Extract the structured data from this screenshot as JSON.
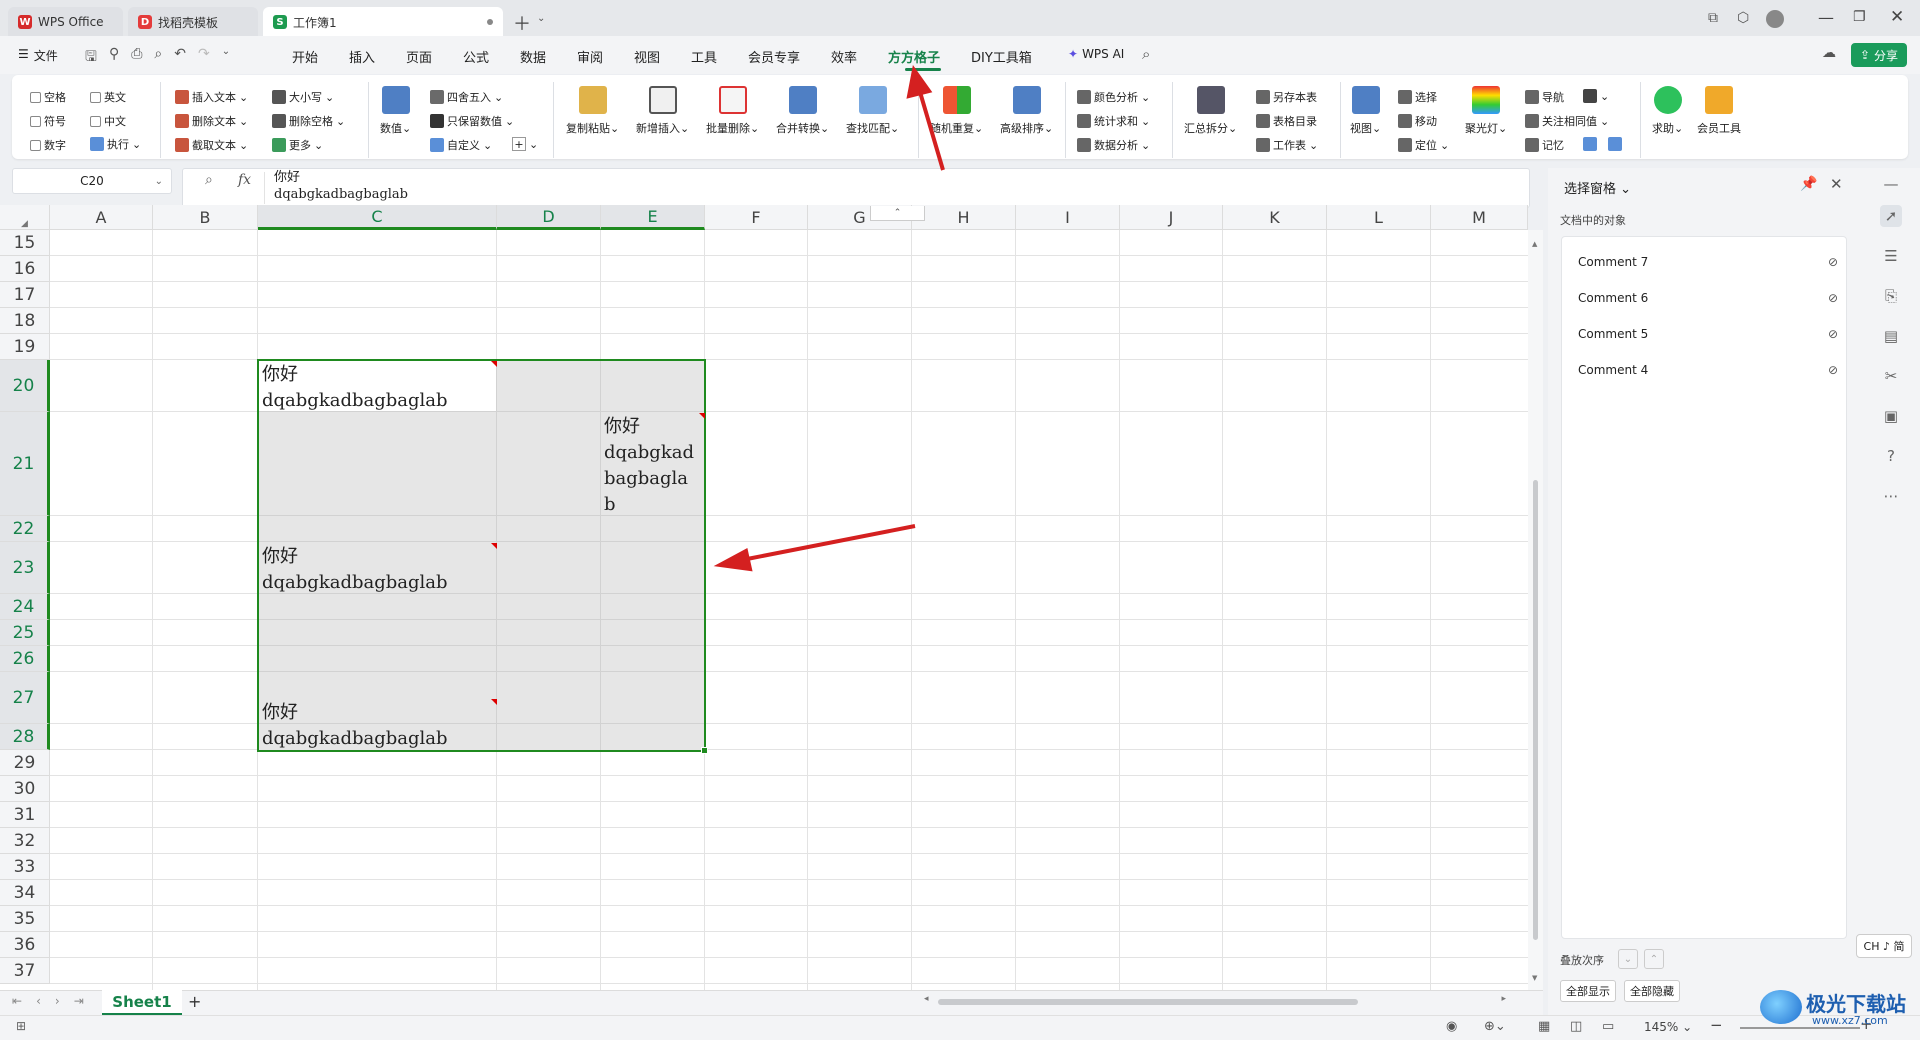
{
  "tabs": [
    {
      "label": "WPS Office",
      "icon": "wps-logo"
    },
    {
      "label": "找稻壳模板",
      "icon": "docer-logo"
    },
    {
      "label": "工作簿1",
      "icon": "sheet-logo"
    }
  ],
  "menu": {
    "file": "文件",
    "items": [
      "开始",
      "插入",
      "页面",
      "公式",
      "数据",
      "审阅",
      "视图",
      "工具",
      "会员专享",
      "效率",
      "方方格子",
      "DIY工具箱"
    ],
    "active": "方方格子",
    "wps_ai": "WPS AI",
    "share": "分享"
  },
  "ribbon": {
    "checks": [
      "空格",
      "英文",
      "符号",
      "中文",
      "数字"
    ],
    "exec": "执行",
    "g2": [
      "插入文本",
      "删除文本",
      "截取文本"
    ],
    "g3": [
      "大小写",
      "删除空格",
      "更多"
    ],
    "numeric": "数值",
    "g4": [
      "四舍五入",
      "只保留数值",
      "自定义"
    ],
    "big1": [
      "复制粘贴",
      "新增插入",
      "批量删除",
      "合并转换",
      "查找匹配",
      "随机重复",
      "高级排序"
    ],
    "g5": [
      "颜色分析",
      "统计求和",
      "数据分析"
    ],
    "summary": "汇总拆分",
    "g6": [
      "另存本表",
      "表格目录",
      "工作表"
    ],
    "view": "视图",
    "g7": [
      "选择",
      "移动",
      "定位"
    ],
    "spotlight": "聚光灯",
    "g8": [
      "导航",
      "关注相同值",
      "记忆"
    ],
    "help": "求助",
    "member_tools": "会员工具"
  },
  "formula": {
    "name_box": "C20",
    "fx": "fx",
    "content_line1": "你好",
    "content_line2": "dqabgkadbagbaglab"
  },
  "columns": [
    "A",
    "B",
    "C",
    "D",
    "E",
    "F",
    "G",
    "H",
    "I",
    "J",
    "K",
    "L",
    "M"
  ],
  "rows": [
    "15",
    "16",
    "17",
    "18",
    "19",
    "20",
    "21",
    "22",
    "23",
    "24",
    "25",
    "26",
    "27",
    "28",
    "29",
    "30",
    "31",
    "32",
    "33",
    "34",
    "35",
    "36",
    "37"
  ],
  "cells": {
    "c20_1": "你好",
    "c20_2": "dqabgkadbagbaglab",
    "e21_1": "你好",
    "e21_2": "dqabgkad",
    "e21_3": "bagbagla",
    "e21_4": "b",
    "c23_1": "你好",
    "c23_2": "dqabgkadbagbaglab",
    "c28_1": "你好",
    "c28_2": "dqabgkadbagbaglab"
  },
  "sheet_tab": "Sheet1",
  "selection_pane": {
    "title": "选择窗格",
    "subtitle": "文档中的对象",
    "items": [
      "Comment 7",
      "Comment 6",
      "Comment 5",
      "Comment 4"
    ],
    "stack_order": "叠放次序",
    "show_all": "全部显示",
    "hide_all": "全部隐藏"
  },
  "status": {
    "zoom": "145%"
  },
  "ime": "CH ♪ 简",
  "watermark": {
    "text": "极光下载站",
    "url": "www.xz7.com"
  },
  "colors": {
    "accent": "#1f8a4c",
    "selection": "#1f8a1f",
    "annotation": "#d42020",
    "menu_active": "#16824a"
  }
}
